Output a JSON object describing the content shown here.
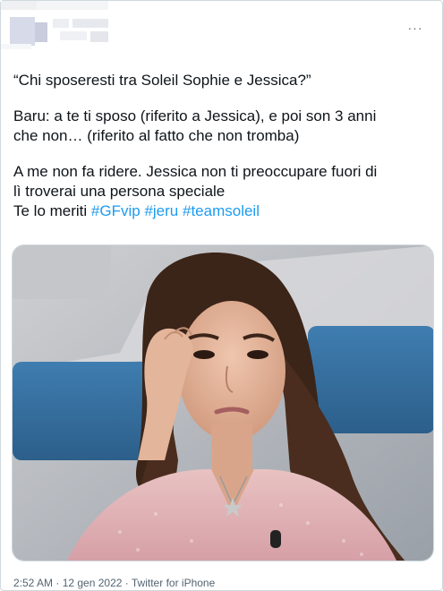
{
  "tweet": {
    "more_icon": "ellipsis-icon",
    "more_label": "···",
    "lines": {
      "quote": "“Chi sposeresti tra Soleil Sophie e Jessica?”",
      "baru_1": "Baru: a te ti sposo (riferito a Jessica), e poi son 3 anni",
      "baru_2": "che non… (riferito al fatto che non tromba)",
      "me_1": "A me non fa ridere. Jessica non ti preoccupare fuori di",
      "me_2": "lì troverai una persona speciale",
      "me_3_prefix": "Te lo meriti ",
      "hashtags": [
        "#GFvip",
        "#jeru",
        "#teamsoleil"
      ]
    },
    "time": "2:52 AM",
    "sep": " · ",
    "date": "12 gen 2022",
    "source": "Twitter for iPhone"
  },
  "colors": {
    "hashtag": "#1d9bf0",
    "meta": "#536471",
    "text": "#0f1419"
  }
}
